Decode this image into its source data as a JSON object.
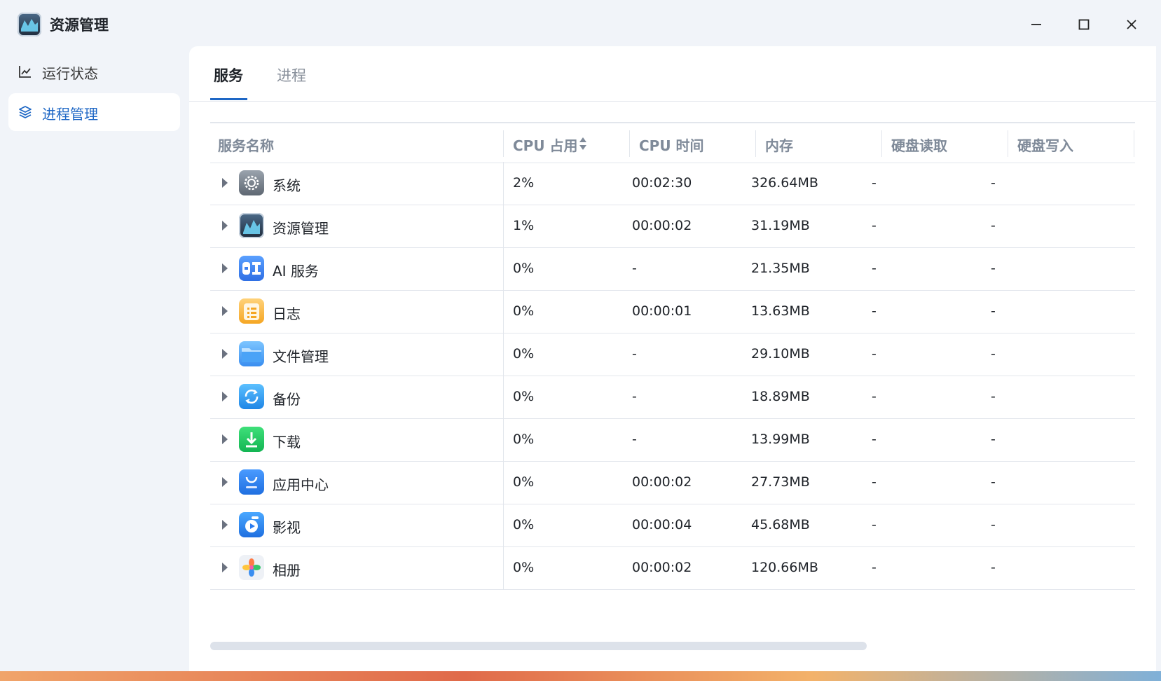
{
  "app": {
    "title": "资源管理",
    "colors": {
      "accent": "#1e67c5",
      "sidebar_bg": "#f1f4f9",
      "content_bg": "#ffffff"
    }
  },
  "window_controls": {
    "minimize": "minimize-icon",
    "maximize": "maximize-icon",
    "close": "close-icon"
  },
  "sidebar": {
    "items": [
      {
        "label": "运行状态",
        "icon": "line-chart-icon",
        "active": false
      },
      {
        "label": "进程管理",
        "icon": "layers-icon",
        "active": true
      }
    ]
  },
  "tabs": [
    {
      "label": "服务",
      "active": true
    },
    {
      "label": "进程",
      "active": false
    }
  ],
  "table": {
    "columns": [
      "服务名称",
      "CPU 占用",
      "CPU 时间",
      "内存",
      "硬盘读取",
      "硬盘写入"
    ],
    "sorted_column": "CPU 占用",
    "rows": [
      {
        "name": "系统",
        "icon": "system-settings-icon",
        "cpu": "2%",
        "cpu_time": "00:02:30",
        "memory": "326.64MB",
        "disk_read": "-",
        "disk_write": "-"
      },
      {
        "name": "资源管理",
        "icon": "resource-monitor-icon",
        "cpu": "1%",
        "cpu_time": "00:00:02",
        "memory": "31.19MB",
        "disk_read": "-",
        "disk_write": "-"
      },
      {
        "name": "AI 服务",
        "icon": "ai-service-icon",
        "cpu": "0%",
        "cpu_time": "-",
        "memory": "21.35MB",
        "disk_read": "-",
        "disk_write": "-"
      },
      {
        "name": "日志",
        "icon": "log-icon",
        "cpu": "0%",
        "cpu_time": "00:00:01",
        "memory": "13.63MB",
        "disk_read": "-",
        "disk_write": "-"
      },
      {
        "name": "文件管理",
        "icon": "folder-icon",
        "cpu": "0%",
        "cpu_time": "-",
        "memory": "29.10MB",
        "disk_read": "-",
        "disk_write": "-"
      },
      {
        "name": "备份",
        "icon": "backup-icon",
        "cpu": "0%",
        "cpu_time": "-",
        "memory": "18.89MB",
        "disk_read": "-",
        "disk_write": "-"
      },
      {
        "name": "下载",
        "icon": "download-icon",
        "cpu": "0%",
        "cpu_time": "-",
        "memory": "13.99MB",
        "disk_read": "-",
        "disk_write": "-"
      },
      {
        "name": "应用中心",
        "icon": "app-store-icon",
        "cpu": "0%",
        "cpu_time": "00:00:02",
        "memory": "27.73MB",
        "disk_read": "-",
        "disk_write": "-"
      },
      {
        "name": "影视",
        "icon": "video-icon",
        "cpu": "0%",
        "cpu_time": "00:00:04",
        "memory": "45.68MB",
        "disk_read": "-",
        "disk_write": "-"
      },
      {
        "name": "相册",
        "icon": "photos-icon",
        "cpu": "0%",
        "cpu_time": "00:00:02",
        "memory": "120.66MB",
        "disk_read": "-",
        "disk_write": "-"
      }
    ]
  }
}
